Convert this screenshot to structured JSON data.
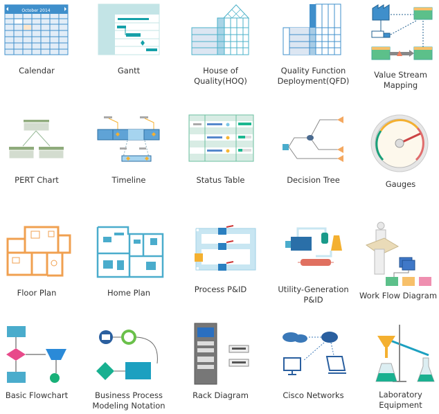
{
  "templates": [
    {
      "label": "Calendar",
      "icon": "calendar-icon",
      "calendar_title": "October 2014"
    },
    {
      "label": "Gantt",
      "icon": "gantt-icon"
    },
    {
      "label": "House of Quality(HOQ)",
      "icon": "house-of-quality-icon"
    },
    {
      "label": "Quality Function Deployment(QFD)",
      "icon": "qfd-icon"
    },
    {
      "label": "Value Stream Mapping",
      "icon": "value-stream-icon"
    },
    {
      "label": "PERT Chart",
      "icon": "pert-chart-icon"
    },
    {
      "label": "Timeline",
      "icon": "timeline-icon"
    },
    {
      "label": "Status Table",
      "icon": "status-table-icon"
    },
    {
      "label": "Decision Tree",
      "icon": "decision-tree-icon"
    },
    {
      "label": "Gauges",
      "icon": "gauge-icon"
    },
    {
      "label": "Floor Plan",
      "icon": "floor-plan-icon"
    },
    {
      "label": "Home Plan",
      "icon": "home-plan-icon"
    },
    {
      "label": "Process P&ID",
      "icon": "process-pid-icon"
    },
    {
      "label": "Utility-Generation P&ID",
      "icon": "utility-pid-icon"
    },
    {
      "label": "Work Flow Diagram",
      "icon": "workflow-icon"
    },
    {
      "label": "Basic Flowchart",
      "icon": "flowchart-icon"
    },
    {
      "label": "Business Process Modeling Notation",
      "icon": "bpmn-icon"
    },
    {
      "label": "Rack Diagram",
      "icon": "rack-icon"
    },
    {
      "label": "Cisco Networks",
      "icon": "cisco-network-icon"
    },
    {
      "label": "Laboratory Equipment",
      "icon": "lab-equipment-icon"
    }
  ],
  "colors": {
    "blue": "#3f8fcb",
    "teal": "#14a0a8",
    "orange": "#f0a050",
    "green": "#5cc08a"
  }
}
